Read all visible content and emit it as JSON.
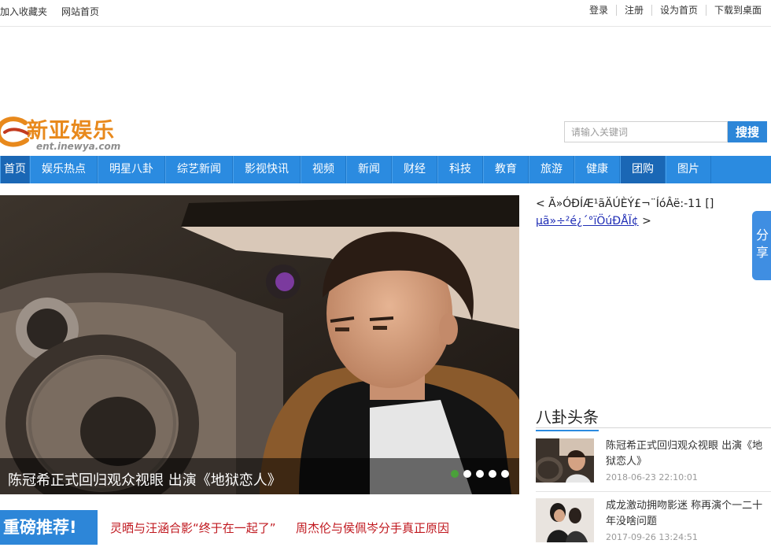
{
  "topbar": {
    "left": [
      "加入收藏夹",
      "网站首页"
    ],
    "right": [
      "登录",
      "注册",
      "设为首页",
      "下载到桌面"
    ]
  },
  "logo": {
    "title": "新亚娱乐",
    "subtitle": "ent.inewya.com"
  },
  "search": {
    "placeholder": "请输入关键词",
    "button": "搜搜"
  },
  "nav": {
    "items": [
      "首页",
      "娱乐热点",
      "明星八卦",
      "综艺新闻",
      "影视快讯",
      "视频",
      "新闻",
      "财经",
      "科技",
      "教育",
      "旅游",
      "健康",
      "团购",
      "图片"
    ],
    "active": [
      "首页",
      "团购"
    ]
  },
  "hero": {
    "caption": "陈冠希正式回归观众视眼 出演《地狱恋人》",
    "slide_count": 5,
    "active_slide": 1
  },
  "featured": {
    "badge": "重磅推荐!",
    "links": [
      "灵晒与汪涵合影“终于在一起了”",
      "周杰伦与侯佩岑分手真正原因"
    ]
  },
  "garbled_ad": {
    "lead": "< Ã»ÓÐÍÆ¹ãÄÚÈÝ£¬¨ÍóÂë:-11 []",
    "link": "µã»÷²é¿´°ïÖúÐÅÏ¢",
    "tail": ">"
  },
  "share": {
    "label_top": "分",
    "label_bottom": "享"
  },
  "gossip": {
    "heading": "八卦头条",
    "items": [
      {
        "title": "陈冠希正式回归观众视眼 出演《地狱恋人》",
        "time": "2018-06-23 22:10:01"
      },
      {
        "title": "成龙激动拥吻影迷 称再演个一二十年没啥问题",
        "time": "2017-09-26 13:24:51"
      }
    ]
  },
  "colors": {
    "brand_blue": "#2b8be0",
    "logo_orange": "#e8891c",
    "featured_red": "#c0181f"
  }
}
